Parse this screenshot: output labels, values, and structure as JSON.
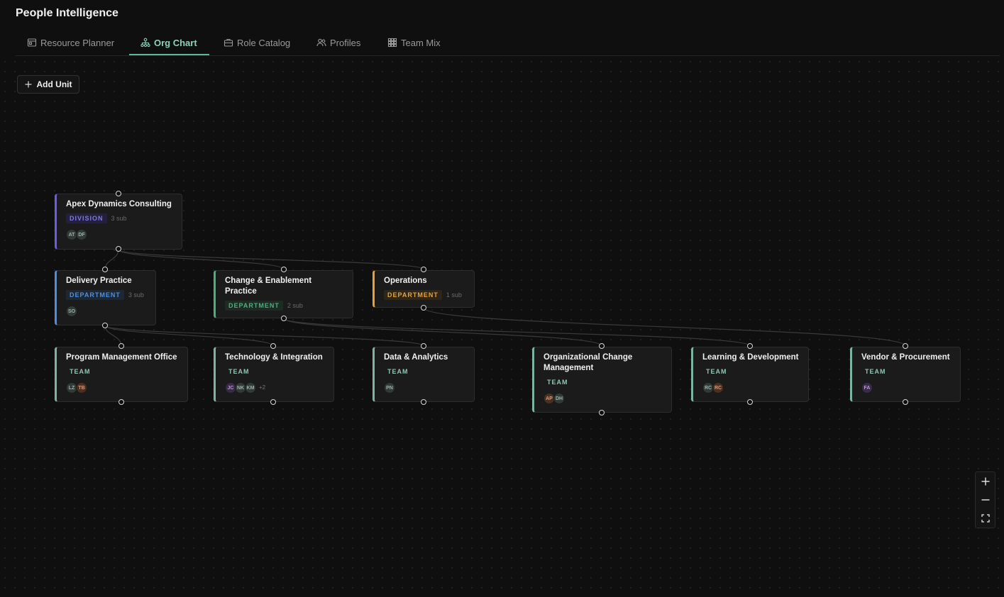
{
  "app": {
    "title": "People Intelligence"
  },
  "tabs": [
    {
      "label": "Resource Planner",
      "icon": "calendar-icon",
      "active": false
    },
    {
      "label": "Org Chart",
      "icon": "org-chart-icon",
      "active": true
    },
    {
      "label": "Role Catalog",
      "icon": "briefcase-icon",
      "active": false
    },
    {
      "label": "Profiles",
      "icon": "users-icon",
      "active": false
    },
    {
      "label": "Team Mix",
      "icon": "grid-icon",
      "active": false
    }
  ],
  "toolbar": {
    "add_unit_label": "Add Unit"
  },
  "colors": {
    "accent": "#5fb597",
    "division": "#6c5ce7",
    "department_delivery": "#4a90e2",
    "department_change": "#4caf7d",
    "department_operations": "#e8a13a",
    "team": "#7fb5a0"
  },
  "nodes": [
    {
      "title": "Apex Dynamics Consulting",
      "type": "DIVISION",
      "sub": "3 sub",
      "avatars": [
        "AT",
        "DF"
      ]
    },
    {
      "title": "Delivery Practice",
      "type": "DEPARTMENT",
      "sub": "3 sub",
      "avatars": [
        "SO"
      ]
    },
    {
      "title": "Change & Enablement Practice",
      "type": "DEPARTMENT",
      "sub": "2 sub",
      "avatars": []
    },
    {
      "title": "Operations",
      "type": "DEPARTMENT",
      "sub": "1 sub",
      "avatars": []
    },
    {
      "title": "Program Management Office",
      "type": "TEAM",
      "sub": "",
      "avatars": [
        "LZ",
        "TB"
      ]
    },
    {
      "title": "Technology & Integration",
      "type": "TEAM",
      "sub": "",
      "avatars": [
        "JC",
        "NK",
        "KM"
      ],
      "more": "+2"
    },
    {
      "title": "Data & Analytics",
      "type": "TEAM",
      "sub": "",
      "avatars": [
        "PN"
      ]
    },
    {
      "title": "Organizational Change Management",
      "type": "TEAM",
      "sub": "",
      "avatars": [
        "AP",
        "DH"
      ]
    },
    {
      "title": "Learning & Development",
      "type": "TEAM",
      "sub": "",
      "avatars": [
        "RC",
        "RC"
      ]
    },
    {
      "title": "Vendor & Procurement",
      "type": "TEAM",
      "sub": "",
      "avatars": [
        "FA"
      ]
    }
  ],
  "zoom_controls": [
    "zoom-in-icon",
    "zoom-out-icon",
    "fit-view-icon"
  ]
}
